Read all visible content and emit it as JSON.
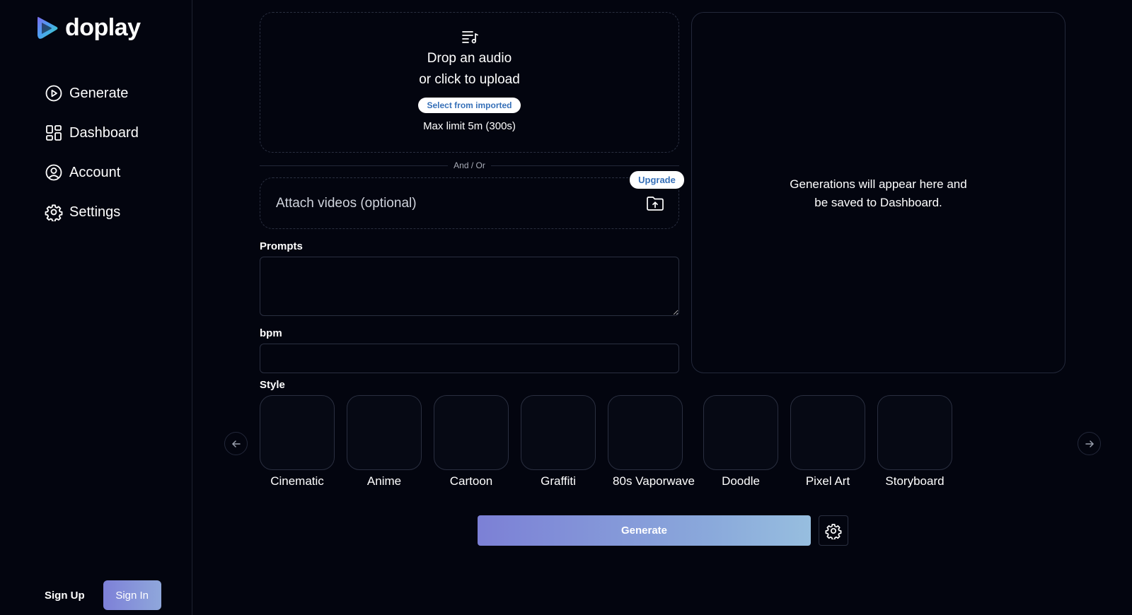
{
  "brand": {
    "name": "doplay"
  },
  "sidebar": {
    "items": [
      {
        "label": "Generate",
        "icon": "play-circle-icon"
      },
      {
        "label": "Dashboard",
        "icon": "dashboard-grid-icon"
      },
      {
        "label": "Account",
        "icon": "user-circle-icon"
      },
      {
        "label": "Settings",
        "icon": "gear-icon"
      }
    ],
    "sign_up": "Sign Up",
    "sign_in": "Sign In"
  },
  "upload": {
    "title_line1": "Drop an audio",
    "title_line2": "or click to upload",
    "select_imported": "Select from imported",
    "max_limit": "Max limit 5m (300s)"
  },
  "divider_text": "And / Or",
  "attach": {
    "placeholder": "Attach videos (optional)",
    "upgrade": "Upgrade"
  },
  "form": {
    "prompts_label": "Prompts",
    "prompts_value": "",
    "bpm_label": "bpm",
    "bpm_value": "",
    "style_label": "Style"
  },
  "styles": [
    "Cinematic",
    "Anime",
    "Cartoon",
    "Graffiti",
    "80s Vaporwave",
    "Doodle",
    "Pixel Art",
    "Storyboard"
  ],
  "generate_button": "Generate",
  "output": {
    "line1": "Generations will appear here and",
    "line2": "be saved to Dashboard."
  },
  "colors": {
    "background": "#03050f",
    "accent_start": "#7c80d6",
    "accent_end": "#97bedf",
    "badge_text": "#3670b8"
  }
}
